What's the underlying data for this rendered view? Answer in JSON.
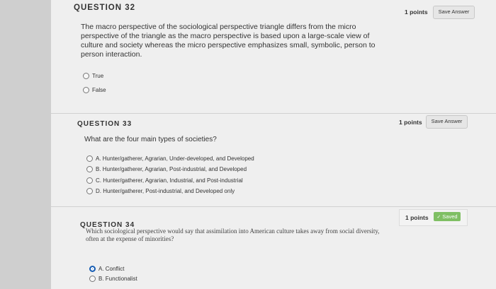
{
  "q32": {
    "header": "QUESTION 32",
    "points": "1 points",
    "save_label": "Save Answer",
    "text": "The macro perspective of the sociological perspective triangle differs from the micro perspective of the triangle as the macro perspective is based upon a large-scale view of culture and society whereas the micro perspective emphasizes small, symbolic, person to person interaction.",
    "options": [
      "True",
      "False"
    ]
  },
  "q33": {
    "header": "QUESTION 33",
    "points": "1 points",
    "save_label": "Save Answer",
    "text": "What are the four main types of societies?",
    "options": [
      "A. Hunter/gatherer, Agrarian, Under-developed, and Developed",
      "B. Hunter/gatherer, Agrarian, Post-industrial, and Developed",
      "C. Hunter/gatherer, Agrarian, Industrial, and Post-industrial",
      "D. Hunter/gatherer, Post-industrial, and Developed only"
    ]
  },
  "q34": {
    "header": "QUESTION 34",
    "points": "1 points",
    "saved_label": "Saved",
    "text": "Which sociological perspective would say that assimilation into American culture takes away from social diversity, often at the expense of minorities?",
    "options": [
      "A. Conflict",
      "B. Functionalist"
    ],
    "selected": "A. Conflict"
  },
  "colors": {
    "accent": "#1a5fb4",
    "saved": "#7fbf64"
  },
  "icons": {
    "saved_check": "check-icon"
  }
}
